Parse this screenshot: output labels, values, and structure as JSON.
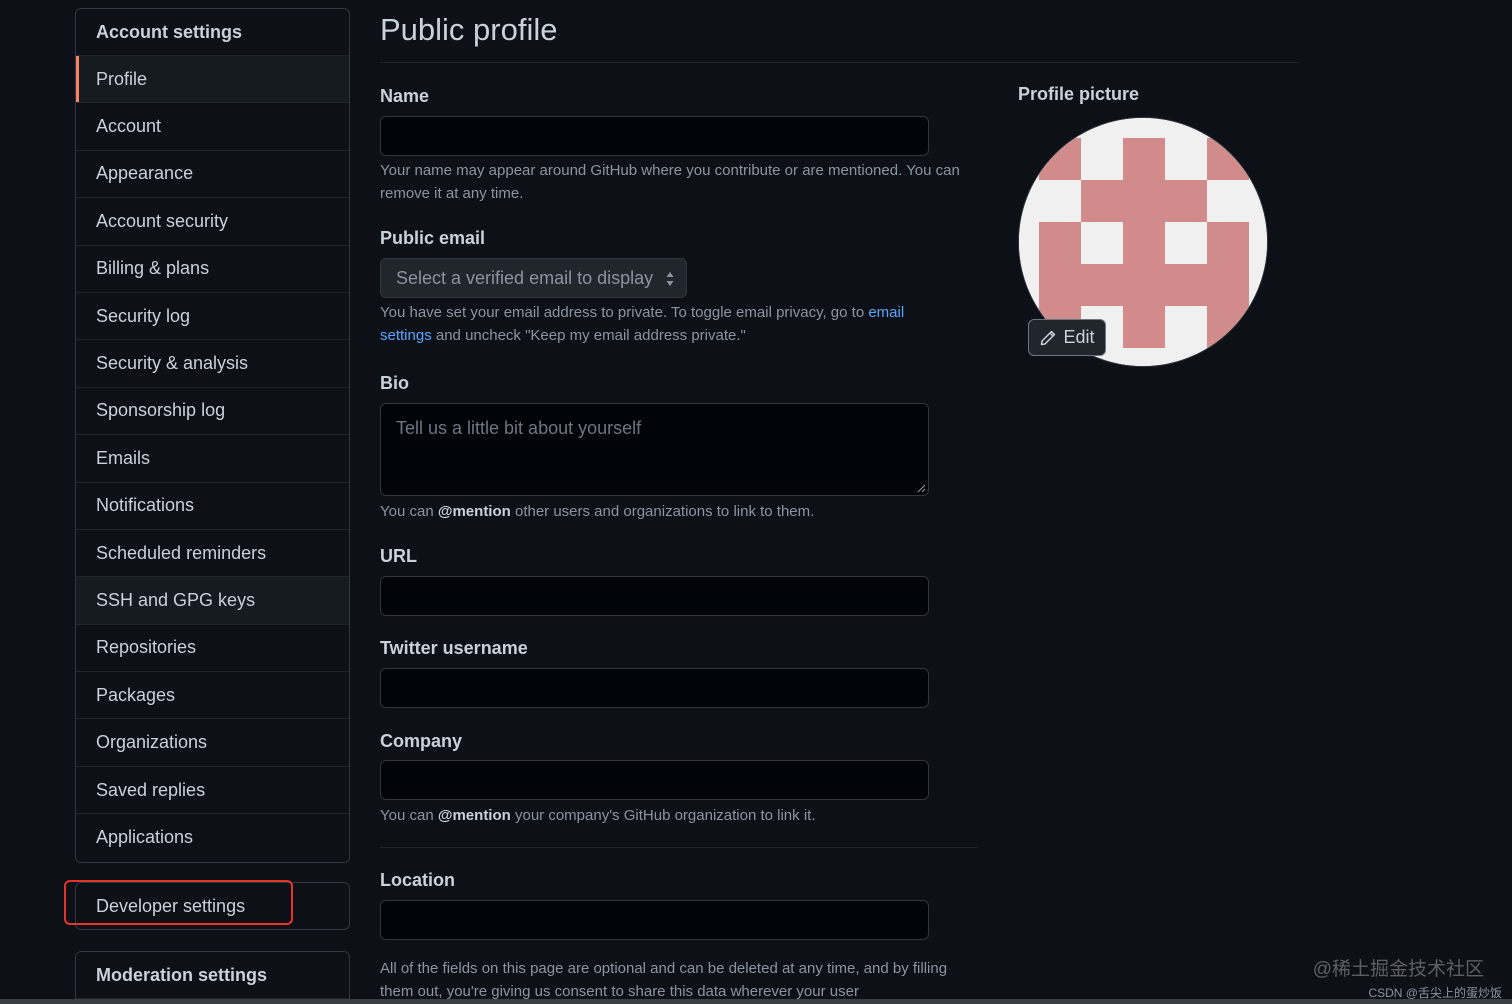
{
  "sidebar": {
    "account_heading": "Account settings",
    "items": [
      {
        "label": "Profile"
      },
      {
        "label": "Account"
      },
      {
        "label": "Appearance"
      },
      {
        "label": "Account security"
      },
      {
        "label": "Billing & plans"
      },
      {
        "label": "Security log"
      },
      {
        "label": "Security & analysis"
      },
      {
        "label": "Sponsorship log"
      },
      {
        "label": "Emails"
      },
      {
        "label": "Notifications"
      },
      {
        "label": "Scheduled reminders"
      },
      {
        "label": "SSH and GPG keys"
      },
      {
        "label": "Repositories"
      },
      {
        "label": "Packages"
      },
      {
        "label": "Organizations"
      },
      {
        "label": "Saved replies"
      },
      {
        "label": "Applications"
      }
    ],
    "selected_index": 0,
    "developer_settings": "Developer settings",
    "moderation_heading": "Moderation settings"
  },
  "main": {
    "title": "Public profile",
    "name_label": "Name",
    "name_value": "",
    "name_note": "Your name may appear around GitHub where you contribute or are mentioned. You can remove it at any time.",
    "public_email_label": "Public email",
    "public_email_select": "Select a verified email to display",
    "email_note_1": "You have set your email address to private. To toggle email privacy, go to ",
    "email_note_link": "email settings",
    "email_note_2": " and uncheck \"Keep my email address private.\"",
    "bio_label": "Bio",
    "bio_placeholder": "Tell us a little bit about yourself",
    "bio_note_1": "You can ",
    "bio_note_mention": "@mention",
    "bio_note_2": " other users and organizations to link to them.",
    "url_label": "URL",
    "twitter_label": "Twitter username",
    "company_label": "Company",
    "company_note_1": "You can ",
    "company_note_mention": "@mention",
    "company_note_2": " your company's GitHub organization to link it.",
    "location_label": "Location",
    "footer_note": "All of the fields on this page are optional and can be deleted at any time, and by filling them out, you're giving us consent to share this data wherever your user"
  },
  "profile_picture": {
    "label": "Profile picture",
    "edit_label": "Edit",
    "avatar_color": "#d18b8b",
    "avatar_bg": "#f0f0f0"
  },
  "watermark": {
    "main": "@稀土掘金技术社区",
    "sub": "CSDN @舌尖上的蛋炒饭"
  },
  "colors": {
    "background": "#0d1117",
    "accent_selected": "#f78166",
    "link": "#58a6ff",
    "highlight_box": "#e5352b"
  }
}
